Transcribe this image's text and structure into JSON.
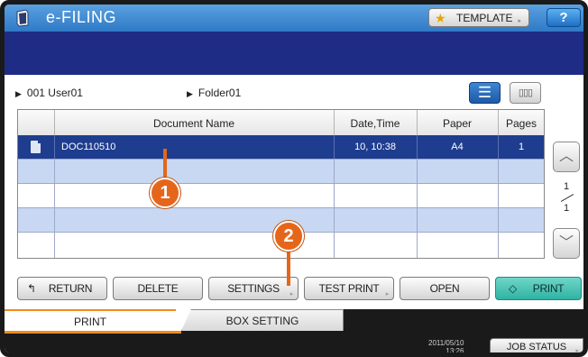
{
  "app": {
    "title": "e-FILING"
  },
  "header": {
    "template_label": "TEMPLATE",
    "help_label": "?"
  },
  "breadcrumb": {
    "box": "001 User01",
    "folder": "Folder01"
  },
  "table": {
    "columns": [
      "Document Name",
      "Date,Time",
      "Paper",
      "Pages"
    ],
    "rows": [
      {
        "name": "DOC110510",
        "datetime": "10, 10:38",
        "paper": "A4",
        "pages": "1",
        "selected": true
      }
    ]
  },
  "pagination": {
    "current": "1",
    "total": "1"
  },
  "actions": {
    "return_label": "RETURN",
    "delete_label": "DELETE",
    "settings_label": "SETTINGS",
    "test_print_label": "TEST PRINT",
    "open_label": "OPEN",
    "print_label": "PRINT"
  },
  "tabs": {
    "print": "PRINT",
    "box_setting": "BOX SETTING"
  },
  "status": {
    "date": "2011/05/10",
    "time": "13:26",
    "job_status_label": "JOB STATUS"
  },
  "callouts": {
    "one": "1",
    "two": "2"
  },
  "colors": {
    "accent": "#1e2c86",
    "selected_row": "#1e3d8f",
    "callout": "#e5661a",
    "print_button": "#2fb3a3"
  }
}
